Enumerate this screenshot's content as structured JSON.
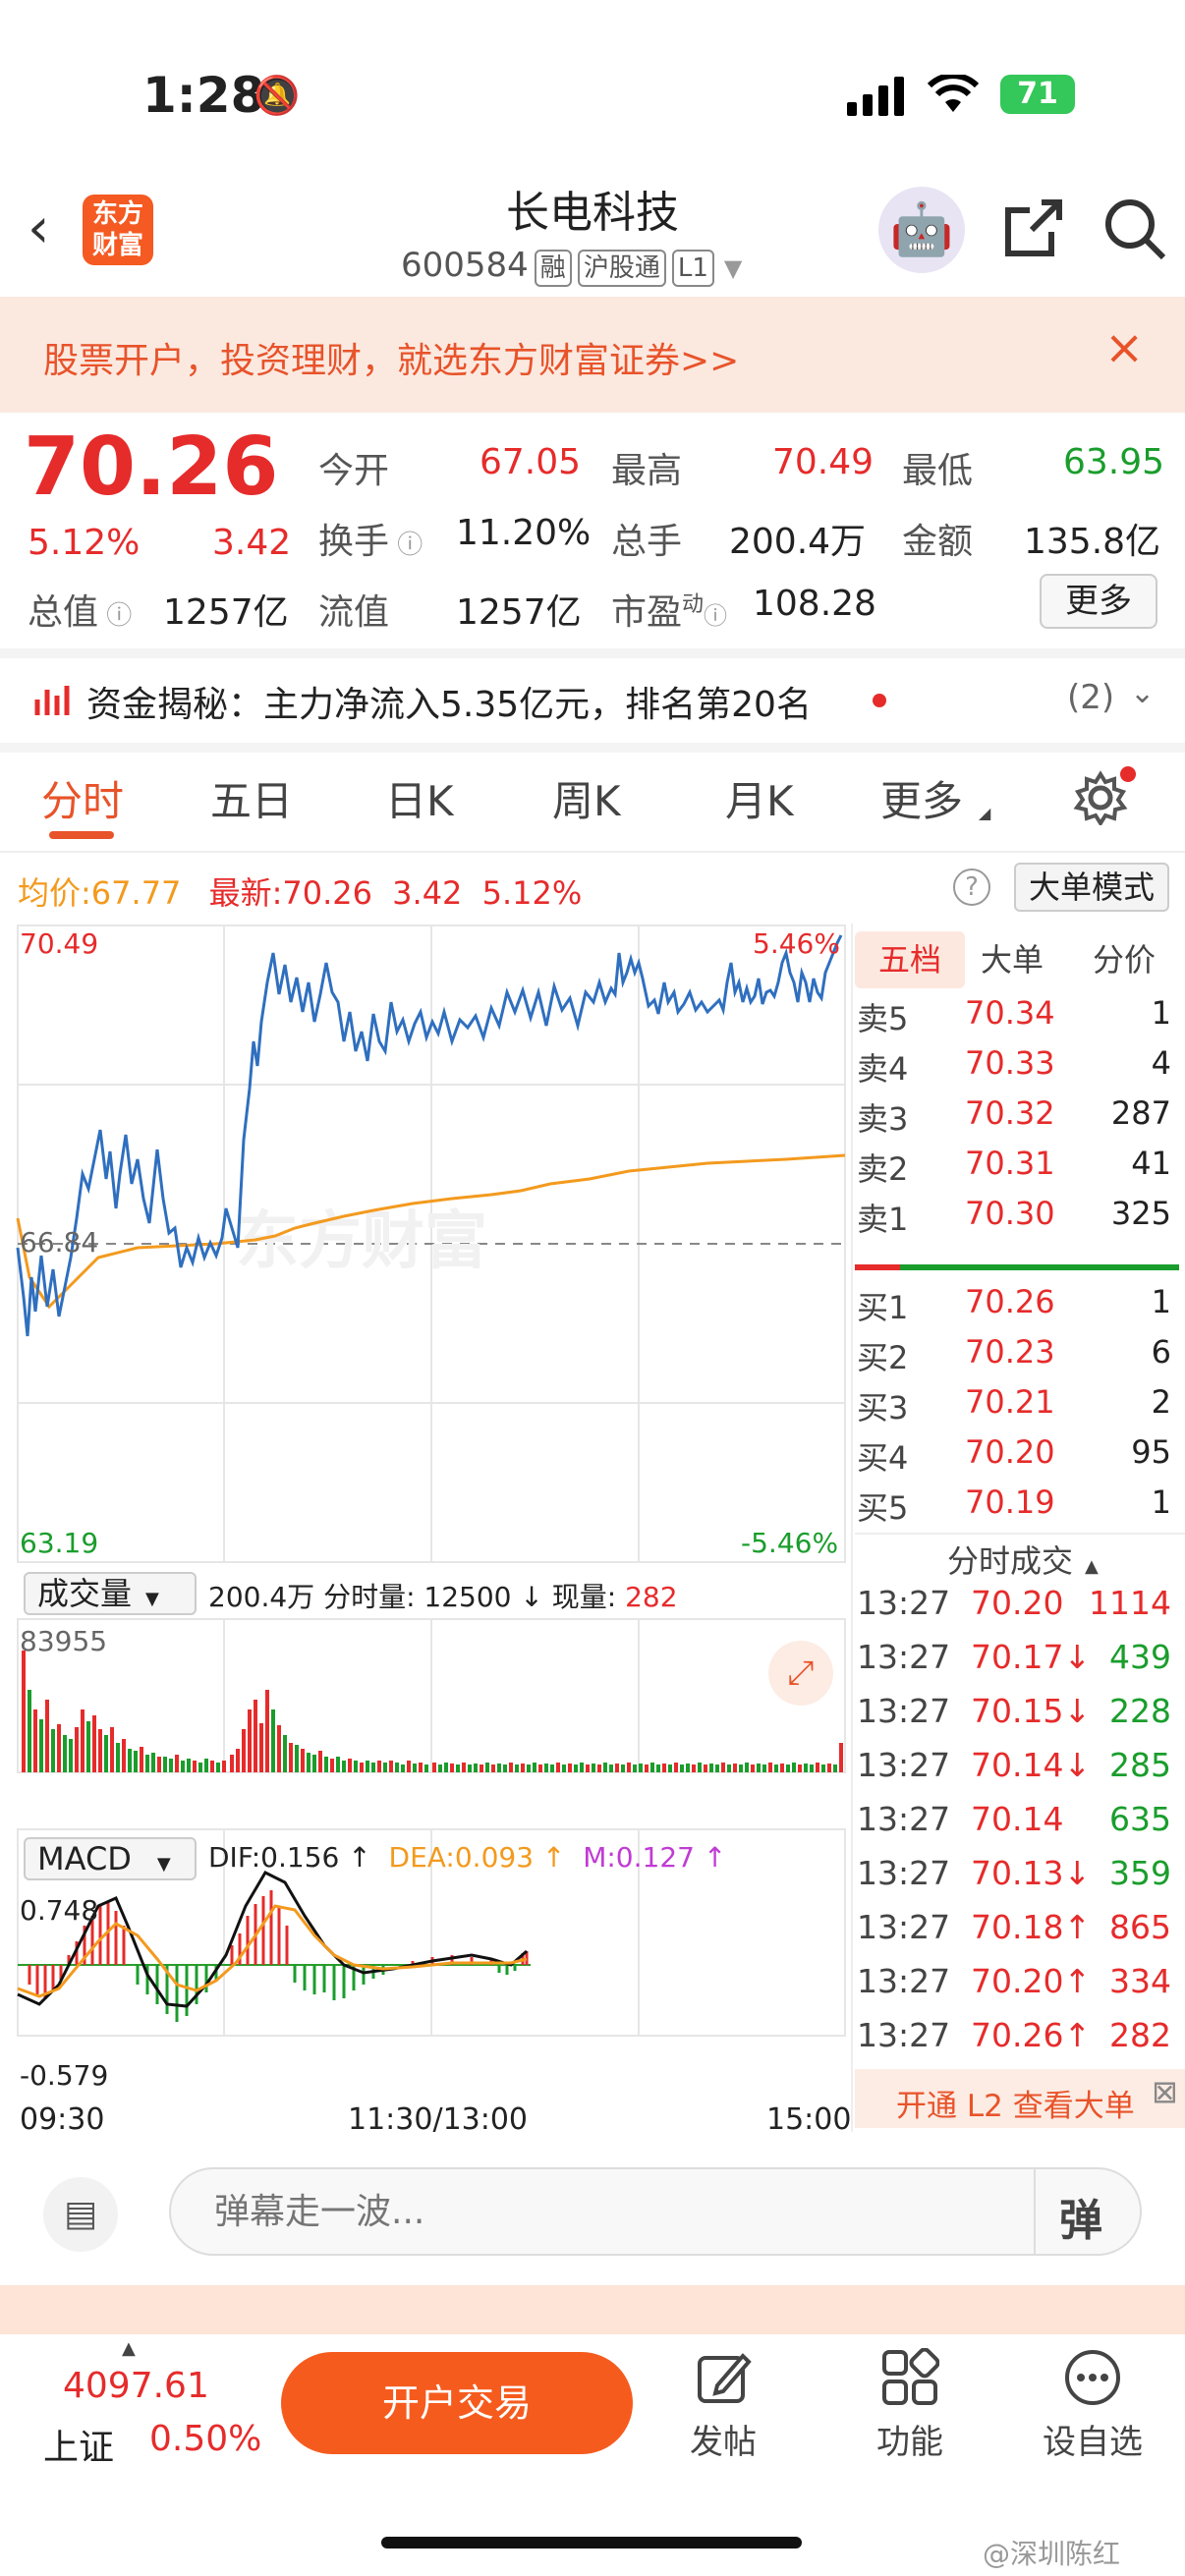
{
  "status": {
    "time": "1:28",
    "battery": "71"
  },
  "header": {
    "title": "长电科技",
    "code": "600584",
    "tags": [
      "融",
      "沪股通",
      "L1"
    ],
    "logo_text": "东方财富"
  },
  "banner": {
    "text": "股票开户，投资理财，就选东方财富证券>>"
  },
  "quote": {
    "price": "70.26",
    "pct": "5.12%",
    "chg": "3.42",
    "open_lbl": "今开",
    "open": "67.05",
    "high_lbl": "最高",
    "high": "70.49",
    "low_lbl": "最低",
    "low": "63.95",
    "turn_lbl": "换手",
    "turn": "11.20%",
    "vol_lbl": "总手",
    "vol": "200.4万",
    "amt_lbl": "金额",
    "amt": "135.8亿",
    "mcap_lbl": "总值",
    "mcap": "1257亿",
    "float_lbl": "流值",
    "float": "1257亿",
    "pe_lbl": "市盈",
    "pe_sup": "动",
    "pe": "108.28",
    "more": "更多"
  },
  "fund": {
    "text": "资金揭秘：主力净流入5.35亿元，排名第20名",
    "count": "(2)"
  },
  "tabs": [
    "分时",
    "五日",
    "日K",
    "周K",
    "月K",
    "更多"
  ],
  "infobar": {
    "avg_lbl": "均价:",
    "avg": "67.77",
    "last_lbl": "最新:",
    "last": "70.26",
    "chg": "3.42",
    "pct": "5.12%",
    "mode_btn": "大单模式"
  },
  "chart": {
    "y_top": "70.49",
    "y_mid": "66.84",
    "y_bot": "63.19",
    "pct_top": "5.46%",
    "pct_bot": "-5.46%",
    "watermark": "东方财富",
    "vol_sel": "成交量",
    "vol_total": "200.4万",
    "vol_fs_lbl": "分时量:",
    "vol_fs": "12500 ↓",
    "vol_now_lbl": "现量:",
    "vol_now": "282",
    "vol_max": "83955",
    "macd_sel": "MACD",
    "dif": "DIF:0.156 ↑",
    "dea": "DEA:0.093 ↑",
    "m": "M:0.127 ↑",
    "macd_top": "0.748",
    "macd_bot": "-0.579",
    "t_start": "09:30",
    "t_mid": "11:30/13:00",
    "t_end": "15:00"
  },
  "orderbook": {
    "tabs": [
      "五档",
      "大单",
      "分价"
    ],
    "asks": [
      {
        "l": "卖5",
        "p": "70.34",
        "v": "1"
      },
      {
        "l": "卖4",
        "p": "70.33",
        "v": "4"
      },
      {
        "l": "卖3",
        "p": "70.32",
        "v": "287"
      },
      {
        "l": "卖2",
        "p": "70.31",
        "v": "41"
      },
      {
        "l": "卖1",
        "p": "70.30",
        "v": "325"
      }
    ],
    "bids": [
      {
        "l": "买1",
        "p": "70.26",
        "v": "1"
      },
      {
        "l": "买2",
        "p": "70.23",
        "v": "6"
      },
      {
        "l": "买3",
        "p": "70.21",
        "v": "2"
      },
      {
        "l": "买4",
        "p": "70.20",
        "v": "95"
      },
      {
        "l": "买5",
        "p": "70.19",
        "v": "1"
      }
    ]
  },
  "trades": {
    "title": "分时成交",
    "rows": [
      {
        "t": "13:27",
        "p": "70.20",
        "v": "1114",
        "c": "red"
      },
      {
        "t": "13:27",
        "p": "70.17↓",
        "v": "439",
        "c": "green"
      },
      {
        "t": "13:27",
        "p": "70.15↓",
        "v": "228",
        "c": "green"
      },
      {
        "t": "13:27",
        "p": "70.14↓",
        "v": "285",
        "c": "green"
      },
      {
        "t": "13:27",
        "p": "70.14",
        "v": "635",
        "c": "green"
      },
      {
        "t": "13:27",
        "p": "70.13↓",
        "v": "359",
        "c": "green"
      },
      {
        "t": "13:27",
        "p": "70.18↑",
        "v": "865",
        "c": "red"
      },
      {
        "t": "13:27",
        "p": "70.20↑",
        "v": "334",
        "c": "red"
      },
      {
        "t": "13:27",
        "p": "70.26↑",
        "v": "282",
        "c": "red"
      }
    ],
    "l2": "开通 L2 查看大单"
  },
  "danmu": {
    "placeholder": "弹幕走一波..."
  },
  "bottom": {
    "index_val": "4097.61",
    "index_name": "上证",
    "index_pct": "0.50%",
    "trade_btn": "开户交易",
    "post": "发帖",
    "func": "功能",
    "watch": "设自选",
    "watermark": "@深圳陈红"
  }
}
